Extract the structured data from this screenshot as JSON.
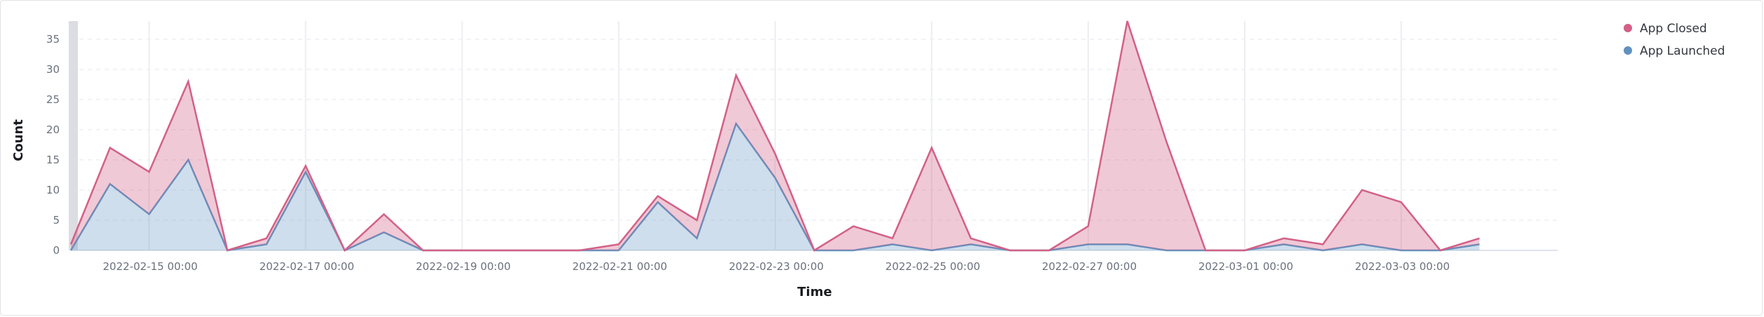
{
  "chart_data": {
    "type": "area",
    "stacked": true,
    "xlabel": "Time",
    "ylabel": "Count",
    "ylim": [
      0,
      38
    ],
    "yticks": [
      0,
      5,
      10,
      15,
      20,
      25,
      30,
      35
    ],
    "x_start": "2022-02-14 00:00",
    "x_end": "2022-03-05 00:00",
    "x_step_hours": 12,
    "xticks": [
      "2022-02-15 00:00",
      "2022-02-17 00:00",
      "2022-02-19 00:00",
      "2022-02-21 00:00",
      "2022-02-23 00:00",
      "2022-02-25 00:00",
      "2022-02-27 00:00",
      "2022-03-01 00:00",
      "2022-03-03 00:00"
    ],
    "grid": true,
    "legend_position": "top-right",
    "series": [
      {
        "name": "App Launched",
        "color": "#6092c0",
        "values": [
          0,
          11,
          6,
          15,
          0,
          1,
          13,
          0,
          3,
          0,
          0,
          0,
          0,
          0,
          0,
          8,
          2,
          21,
          12,
          0,
          0,
          1,
          0,
          1,
          0,
          0,
          1,
          1,
          0,
          0,
          0,
          1,
          0,
          1,
          0,
          0,
          1
        ]
      },
      {
        "name": "App Closed",
        "color": "#d36086",
        "values": [
          1,
          6,
          7,
          13,
          0,
          1,
          1,
          0,
          3,
          0,
          0,
          0,
          0,
          0,
          1,
          1,
          3,
          8,
          4,
          0,
          4,
          1,
          17,
          1,
          0,
          0,
          3,
          37,
          18,
          0,
          0,
          1,
          1,
          9,
          8,
          0,
          1
        ]
      }
    ]
  }
}
